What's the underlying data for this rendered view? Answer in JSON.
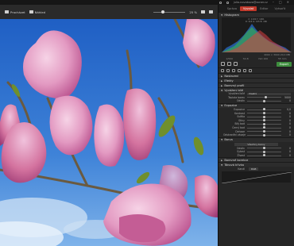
{
  "topbar": {
    "user": "julia.novakova@zoner.cz",
    "window_controls": [
      "–",
      "□",
      "✕"
    ]
  },
  "toolbar": {
    "browse_label": "Procházet",
    "view_label": "Náhled",
    "zoom_value": 0.3,
    "zoom_label": "25 %"
  },
  "panel": {
    "modes": [
      "Správa",
      "Vyvolat",
      "Editor",
      "Vytvořit"
    ],
    "active_mode": "Vyvolat",
    "histogram_title": "Histogram",
    "histogram_coords": "X: 1190  Y: 1001",
    "histogram_rgb": "R: 116  G: 145  B: 180",
    "image_info": "4000 × 3000  20,0 MB",
    "exif": [
      "1/500",
      "f/2,8",
      "ISO 100",
      "55 mm"
    ],
    "export_label": "Export",
    "sections": {
      "presets": "Nastavení",
      "effects": "Efekty",
      "color_profile": "Barevný profil",
      "white_balance": "Vyvážení bílé",
      "exposure": "Expozice",
      "color": "Barva",
      "color_correction": "Barevné korekce",
      "tone_curve": "Tónová křivka"
    },
    "wb_rows": [
      {
        "label": "Vyvážení bílé",
        "select": "Vlastní"
      },
      {
        "label": "Teplota barev",
        "value": "5000",
        "pos": 0.55
      },
      {
        "label": "Odstín",
        "value": "0",
        "pos": 0.5
      }
    ],
    "exposure_rows": [
      {
        "label": "Expozice",
        "value": "0,0",
        "pos": 0.5
      },
      {
        "label": "Kontrast",
        "value": "0",
        "pos": 0.5
      },
      {
        "label": "Světla",
        "value": "0",
        "pos": 0.5
      },
      {
        "label": "Stíny",
        "value": "0",
        "pos": 0.5
      },
      {
        "label": "Bílý bod",
        "value": "0",
        "pos": 0.5
      },
      {
        "label": "Černý bod",
        "value": "0",
        "pos": 0.5
      },
      {
        "label": "Dehaze",
        "value": "0",
        "pos": 0.5
      },
      {
        "label": "Odstranění závoje",
        "value": "0",
        "pos": 0.5
      }
    ],
    "color_dropdown": "Všechny barvy",
    "color_rows": [
      {
        "label": "Odstín",
        "value": "0",
        "pos": 0.5
      },
      {
        "label": "Sytost",
        "value": "0",
        "pos": 0.5
      },
      {
        "label": "Živost",
        "value": "0",
        "pos": 0.5
      }
    ],
    "curve_mode_label": "Kanál",
    "curve_channel": "RGB"
  },
  "colors": {
    "accent": "#c0392b",
    "export_green": "#3e8e3e",
    "sky": "#3b78d0",
    "petal": "#e39ac2"
  }
}
